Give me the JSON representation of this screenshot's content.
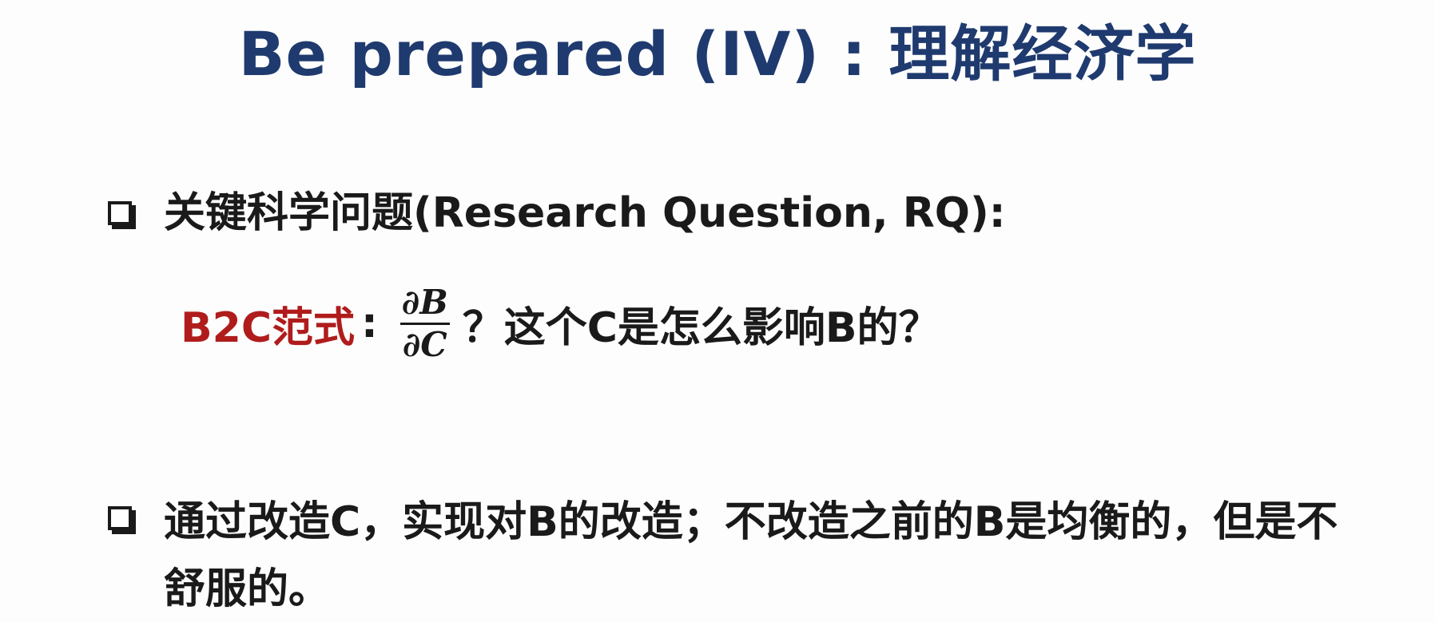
{
  "slide": {
    "title": "Be prepared (IV) : 理解经济学",
    "bullets": [
      {
        "text": "关键科学问题(Research Question, RQ):"
      },
      {
        "text": "通过改造C，实现对B的改造；不改造之前的B是均衡的，但是不舒服的。"
      }
    ],
    "sub_item": {
      "paradigm_label": "B2C范式",
      "colon": ":",
      "fraction": {
        "numerator": "∂B",
        "denominator": "∂C"
      },
      "question": "？这个C是怎么影响B的？"
    },
    "colors": {
      "title": "#1f3a6e",
      "paradigm": "#b01c1c",
      "text": "#1a1a1a"
    }
  }
}
